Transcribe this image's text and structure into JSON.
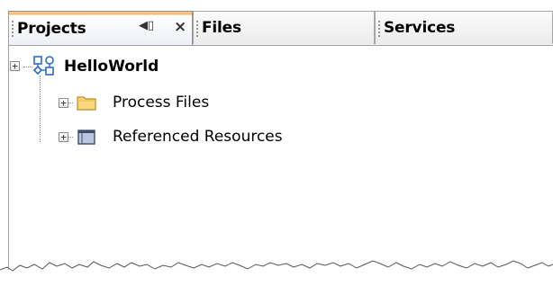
{
  "tabs": [
    {
      "label": "Projects",
      "active": true,
      "minimize_icon": "◀▯",
      "close_icon": "×"
    },
    {
      "label": "Files",
      "active": false
    },
    {
      "label": "Services",
      "active": false
    }
  ],
  "tree": {
    "root": {
      "label": "HelloWorld",
      "icon": "project-icon",
      "expanded": false
    },
    "children": [
      {
        "label": "Process Files",
        "icon": "folder-icon"
      },
      {
        "label": "Referenced Resources",
        "icon": "resources-folder-icon"
      }
    ]
  },
  "expander_symbol": "+",
  "colors": {
    "active_tab_accent": "#f2b660",
    "folder_fill": "#f7d87c",
    "project_icon": "#2c6bbf",
    "dotted_line": "#888888"
  }
}
